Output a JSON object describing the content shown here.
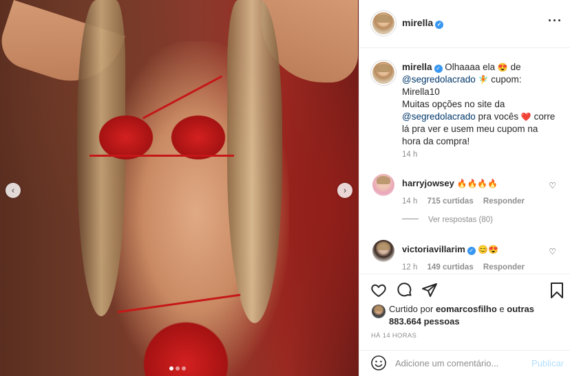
{
  "media": {
    "nav_prev_icon": "chevron-left-icon",
    "nav_next_icon": "chevron-right-icon",
    "nav_prev_glyph": "‹",
    "nav_next_glyph": "›",
    "carousel_count": 3,
    "carousel_active": 1
  },
  "header": {
    "username": "mirella",
    "verified_glyph": "✓",
    "more_glyph": "···"
  },
  "caption": {
    "username": "mirella",
    "text_1": "Olhaaaa ela",
    "emoji_1": "😍",
    "text_2": "de",
    "mention_1": "@segredolacrado",
    "emoji_2": "🧚",
    "text_3": "cupom:",
    "text_4": "Mirella10",
    "text_5": "Muitas opções no site da",
    "mention_2": "@segredolacrado",
    "text_6": "pra vocês",
    "emoji_3": "❤️",
    "text_7": "corre lá pra ver e usem meu cupom na hora da compra!",
    "time": "14 h"
  },
  "comments": [
    {
      "username": "harryjowsey",
      "text": "🔥🔥🔥🔥",
      "time": "14 h",
      "likes": "715 curtidas",
      "reply": "Responder",
      "view_replies": "Ver respostas (80)"
    },
    {
      "username": "victoriavillarim",
      "text": "😊😍",
      "time": "12 h",
      "likes": "149 curtidas",
      "reply": "Responder"
    }
  ],
  "like_glyph": "♡",
  "liked_by": {
    "prefix": "Curtido por",
    "user": "eomarcosfilho",
    "middle": "e",
    "others": "outras 883.664 pessoas"
  },
  "posted_ago": "HÁ 14 HORAS",
  "add_comment": {
    "placeholder": "Adicione um comentário...",
    "publish": "Publicar"
  },
  "colors": {
    "link": "#00376b",
    "verified": "#3897f0",
    "publish_disabled": "#b2dffc",
    "muted": "#8e8e8e"
  }
}
